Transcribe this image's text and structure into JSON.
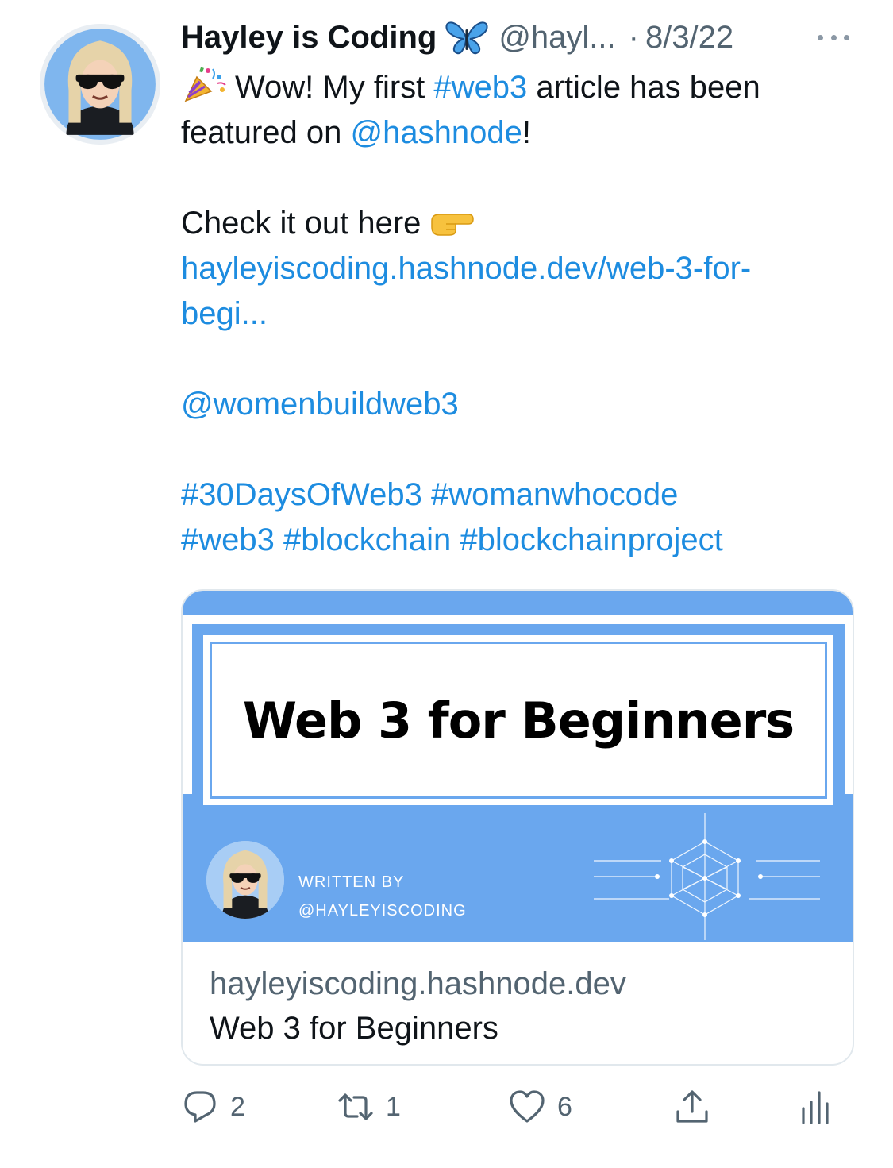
{
  "tweet": {
    "author": {
      "display_name": "Hayley is Coding",
      "name_emoji": "butterfly-emoji",
      "handle": "@hayl...",
      "avatar": "cartoon-avatar-sunglasses"
    },
    "separator": "·",
    "date": "8/3/22",
    "more_icon": "more-horizontal-icon",
    "text": {
      "line1_emoji": "party-popper-emoji",
      "line1_pre": "Wow! My first ",
      "line1_tag": "#web3",
      "line1_post": " article has been",
      "line2_pre": "featured on ",
      "line2_mention": "@hashnode",
      "line2_post": "!",
      "line3": "Check it out here",
      "line3_emoji": "pointing-right-emoji",
      "link_line1": "hayleyiscoding.hashnode.dev/web-3-for-",
      "link_line2": "begi...",
      "mention2": "@womenbuildweb3",
      "tags_line1": [
        "#30DaysOfWeb3",
        "#womanwhocode"
      ],
      "tags_line2": [
        "#web3",
        "#blockchain",
        "#blockchainproject"
      ]
    },
    "card": {
      "image_title": "Web 3 for Beginners",
      "written_by": "WRITTEN BY",
      "written_handle": "@HAYLEYISCODING",
      "domain": "hayleyiscoding.hashnode.dev",
      "title": "Web 3 for Beginners"
    },
    "actions": {
      "reply": {
        "icon": "reply-icon",
        "count": "2"
      },
      "retweet": {
        "icon": "retweet-icon",
        "count": "1"
      },
      "like": {
        "icon": "heart-icon",
        "count": "6"
      },
      "share": {
        "icon": "share-icon"
      },
      "analytics": {
        "icon": "analytics-icon"
      }
    },
    "colors": {
      "link": "#1d8ce0",
      "card_accent": "#6aa7ee",
      "secondary_text": "#536471"
    }
  }
}
